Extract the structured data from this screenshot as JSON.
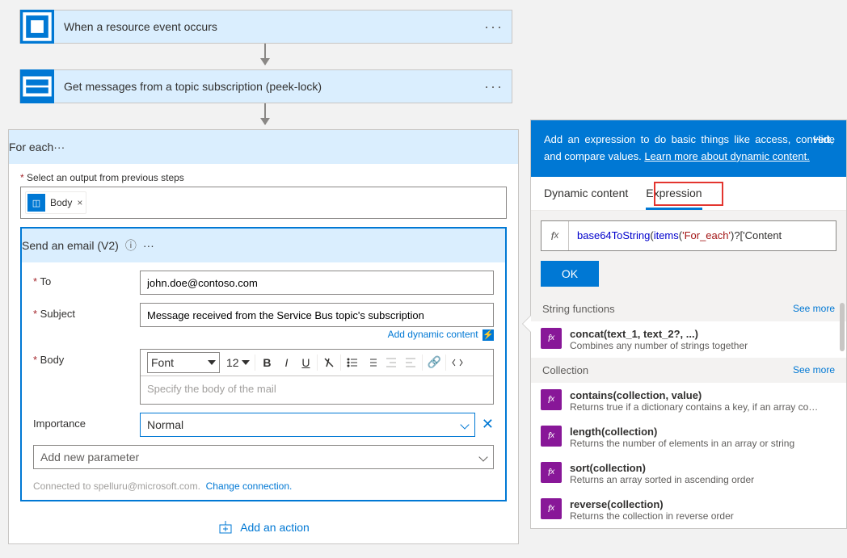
{
  "steps": {
    "trigger": {
      "title": "When a resource event occurs"
    },
    "action1": {
      "title": "Get messages from a topic subscription (peek-lock)"
    },
    "foreach": {
      "title": "For each"
    },
    "email": {
      "title": "Send an email (V2)"
    }
  },
  "foreach_body": {
    "select_label": "Select an output from previous steps",
    "token": "Body"
  },
  "email_form": {
    "to_label": "To",
    "to_value": "john.doe@contoso.com",
    "subject_label": "Subject",
    "subject_value": "Message received from the Service Bus topic's subscription",
    "dyn_link": "Add dynamic content",
    "body_label": "Body",
    "font_label": "Font",
    "font_size": "12",
    "body_placeholder": "Specify the body of the mail",
    "importance_label": "Importance",
    "importance_value": "Normal",
    "add_param": "Add new parameter",
    "connected": "Connected to spelluru@microsoft.com.",
    "change_conn": "Change connection."
  },
  "add_action": "Add an action",
  "panel": {
    "intro_a": "Add an expression to do basic things like access, convert, and compare values.",
    "intro_link": "Learn more about dynamic content.",
    "hide": "Hide",
    "tab1": "Dynamic content",
    "tab2": "Expression",
    "fx_value_fn": "base64ToString",
    "fx_value_arg_call": "items",
    "fx_value_arg_str": "'For_each'",
    "fx_value_tail": ")?['Content",
    "ok": "OK",
    "cat_string": "String functions",
    "cat_collection": "Collection",
    "seemore": "See more",
    "fns": {
      "concat_sig": "concat(text_1, text_2?, ...)",
      "concat_desc": "Combines any number of strings together",
      "contains_sig": "contains(collection, value)",
      "contains_desc": "Returns true if a dictionary contains a key, if an array cont...",
      "length_sig": "length(collection)",
      "length_desc": "Returns the number of elements in an array or string",
      "sort_sig": "sort(collection)",
      "sort_desc": "Returns an array sorted in ascending order",
      "reverse_sig": "reverse(collection)",
      "reverse_desc": "Returns the collection in reverse order"
    }
  }
}
